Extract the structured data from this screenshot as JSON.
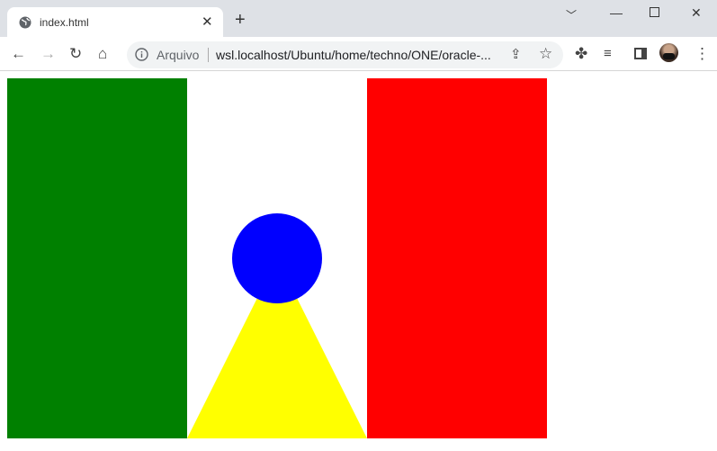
{
  "tab": {
    "title": "index.html"
  },
  "omnibox": {
    "scheme_label": "Arquivo",
    "url": "wsl.localhost/Ubuntu/home/techno/ONE/oracle-..."
  },
  "canvas": {
    "colors": {
      "left": "#008000",
      "middle": "#ffffff",
      "right": "#ff0000",
      "circle": "#0000ff",
      "triangle": "#ffff00"
    }
  }
}
